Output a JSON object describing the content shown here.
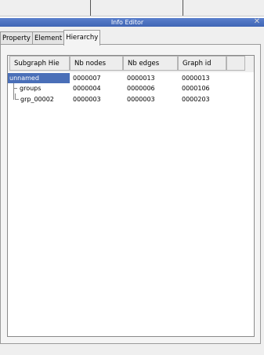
{
  "window": {
    "title": "Info Editor",
    "close_symbol": "✕"
  },
  "tabs": [
    {
      "label": "Property"
    },
    {
      "label": "Element"
    },
    {
      "label": "Hierarchy"
    }
  ],
  "tree": {
    "columns": [
      "Subgraph Hie",
      "Nb nodes",
      "Nb edges",
      "Graph id"
    ],
    "rows": [
      {
        "name": "unnamed",
        "nodes": "0000007",
        "edges": "0000013",
        "id": "0000013"
      },
      {
        "name": "groups",
        "nodes": "0000004",
        "edges": "0000006",
        "id": "0000106"
      },
      {
        "name": "grp_00002",
        "nodes": "0000003",
        "edges": "0000003",
        "id": "0000203"
      }
    ]
  }
}
